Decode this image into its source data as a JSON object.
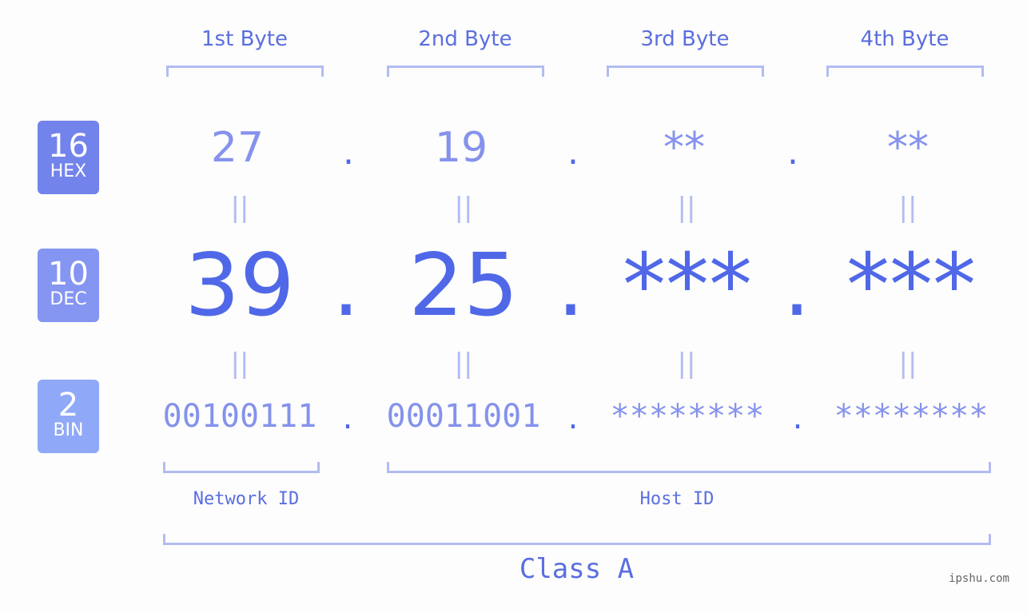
{
  "colors": {
    "hex_badge": "#7383ec",
    "dec_badge": "#8595f2",
    "bin_badge": "#90a8f8",
    "accent": "#5068e8",
    "bracket": "#b2bcf3"
  },
  "badges": [
    {
      "num": "16",
      "label": "HEX"
    },
    {
      "num": "10",
      "label": "DEC"
    },
    {
      "num": "2",
      "label": "BIN"
    }
  ],
  "byte_headers": [
    "1st Byte",
    "2nd Byte",
    "3rd Byte",
    "4th Byte"
  ],
  "hex_values": [
    "27",
    "19",
    "**",
    "**"
  ],
  "dec_values": [
    "39",
    "25",
    "***",
    "***"
  ],
  "bin_values": [
    "00100111",
    "00011001",
    "********",
    "********"
  ],
  "separator": ".",
  "equals": "||",
  "network_id_label": "Network ID",
  "host_id_label": "Host ID",
  "class_label": "Class A",
  "watermark": "ipshu.com"
}
